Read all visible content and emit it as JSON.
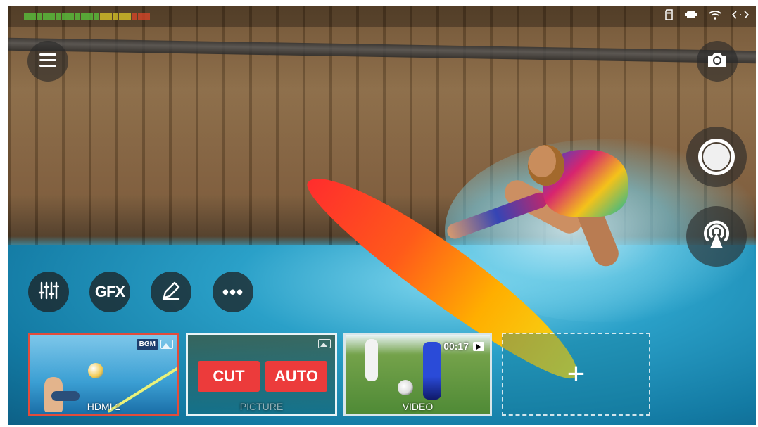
{
  "status_bar": {
    "audio_meter_levels": 20,
    "icons": [
      "sd-card-icon",
      "battery-icon",
      "wifi-icon",
      "network-icon"
    ]
  },
  "top_controls": {
    "menu_icon": "menu-icon",
    "camera_icon": "camera-icon"
  },
  "right_controls": {
    "record_icon": "record-icon",
    "stream_icon": "broadcast-icon"
  },
  "toolbar": {
    "mixer_icon": "sliders-icon",
    "gfx_label": "GFX",
    "pen_icon": "pen-icon",
    "more_label": "•••"
  },
  "sources": [
    {
      "label": "HDMI 1",
      "badge": "BGM",
      "selected": true
    },
    {
      "label": "PICTURE",
      "cut_label": "CUT",
      "auto_label": "AUTO"
    },
    {
      "label": "VIDEO",
      "time": "00:17"
    },
    {
      "label": "+"
    }
  ],
  "colors": {
    "accent_red": "#ec3b3b",
    "selected_border": "#e24c3b"
  }
}
